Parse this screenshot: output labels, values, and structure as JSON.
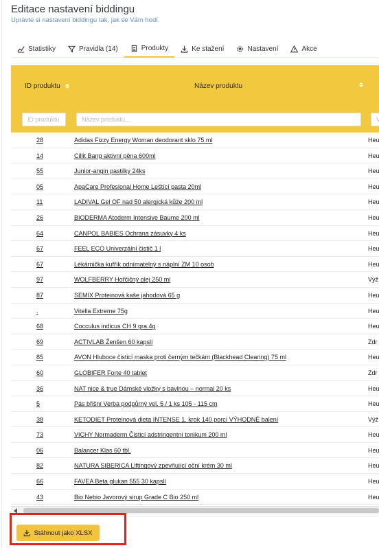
{
  "header": {
    "title": "Editace nastavení biddingu",
    "subtitle": "Upravte si nastavení biddingu tak, jak se Vám hodí."
  },
  "tabs": [
    {
      "label": "Statistiky",
      "icon": "chart-line-icon"
    },
    {
      "label": "Pravidla (14)",
      "icon": "filter-icon"
    },
    {
      "label": "Produkty",
      "icon": "clipboard-icon",
      "active": true
    },
    {
      "label": "Ke stažení",
      "icon": "download-icon"
    },
    {
      "label": "Nastavení",
      "icon": "gear-icon"
    },
    {
      "label": "Akce",
      "icon": "warning-icon"
    }
  ],
  "table": {
    "columns": {
      "id": "ID produktu",
      "name": "Název produktu"
    },
    "filters": {
      "id_placeholder": "ID produktu",
      "name_placeholder": "Název produktu...",
      "third_placeholder": "Výrobce"
    },
    "rows": [
      {
        "id": "28",
        "name": "Adidas Fizzy Energy Woman deodorant sklo 75 ml",
        "status": "Heu"
      },
      {
        "id": "14",
        "name": "Cillit Bang aktivní pěna 600ml",
        "status": "Heu"
      },
      {
        "id": "55",
        "name": "Junior-angin pastilky 24ks",
        "status": "Heu"
      },
      {
        "id": "05",
        "name": "ApaCare Profesional Home Leštící pasta 20ml",
        "status": "Heu"
      },
      {
        "id": "11",
        "name": "LADIVAL Gel OF nad 50 alergická kůže 200 ml",
        "status": "Heu"
      },
      {
        "id": "26",
        "name": "BIODERMA Atoderm Intensive Baume 200 ml",
        "status": "Heu"
      },
      {
        "id": "64",
        "name": "CANPOL BABIES Ochrana zásuvky 4 ks",
        "status": "Heu"
      },
      {
        "id": "67",
        "name": "FEEL ECO Univerzální čistič 1 l",
        "status": "Heu"
      },
      {
        "id": "67",
        "name": "Lékárnička kufřík odnímatelný s náplní ZM 10 osob",
        "status": "Heu"
      },
      {
        "id": "97",
        "name": "WOLFBERRY Hořčičný olej 250 ml",
        "status": "Výž"
      },
      {
        "id": "87",
        "name": "SEMIX Proteinová kaše jahodová 65 g",
        "status": "Heu"
      },
      {
        "id": ".",
        "name": "Vitella Extreme 75g",
        "status": "Heu"
      },
      {
        "id": "68",
        "name": "Cocculus indicus CH 9 gra.4g",
        "status": "Heu"
      },
      {
        "id": "69",
        "name": "ACTIVLAB Ženšen 60 kapslí",
        "status": "Zdr"
      },
      {
        "id": "85",
        "name": "AVON Hluboce čisticí maska proti černým tečkám (Blackhead Clearing) 75 ml",
        "status": "Heu"
      },
      {
        "id": "60",
        "name": "GLOBIFER Forte 40 tablet",
        "status": "Zdr"
      },
      {
        "id": "36",
        "name": "NAT nice & true Dámské vložky s bavlnou – normal 20 ks",
        "status": "Heu"
      },
      {
        "id": "5",
        "name": "Pás břišní Verba podpůrný vel. 5 / 1 ks 105 - 115 cm",
        "status": "Heu"
      },
      {
        "id": "38",
        "name": "KETODIET Proteinová dieta INTENSE 1. krok 140 porcí VÝHODNÉ balení",
        "status": "Výž"
      },
      {
        "id": "73",
        "name": "VICHY Normaderm Čisticí adstringentní tonikum 200 ml",
        "status": "Heu"
      },
      {
        "id": "06",
        "name": "Balancer Klas 60 tbl.",
        "status": "Heu"
      },
      {
        "id": "82",
        "name": "NATURA SIBERICA Liftingový zpevňující oční krém 30 ml",
        "status": "Heu"
      },
      {
        "id": "66",
        "name": "FAVEA Beta glukan 555 30 kapslí",
        "status": "Heu"
      },
      {
        "id": "43",
        "name": "Bio Nebio Javorový sirup Grade C Bio 250 ml",
        "status": "Heu"
      }
    ]
  },
  "footer": {
    "download_label": "Stáhnout jako XLSX"
  },
  "colors": {
    "accent": "#f2c33d",
    "highlight": "#e2231a"
  }
}
